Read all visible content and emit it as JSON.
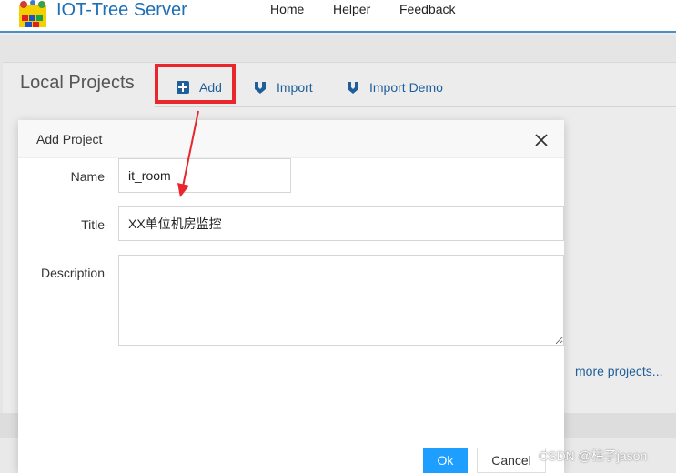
{
  "app": {
    "title": "IOT-Tree Server"
  },
  "nav": {
    "items": [
      {
        "label": "Home"
      },
      {
        "label": "Helper"
      },
      {
        "label": "Feedback"
      }
    ]
  },
  "panel": {
    "title": "Local Projects",
    "add_label": "Add",
    "import_label": "Import",
    "import_demo_label": "Import Demo",
    "more_projects": "more projects..."
  },
  "modal": {
    "title": "Add Project",
    "name_label": "Name",
    "name_value": "it_room",
    "title_label": "Title",
    "title_value": "XX单位机房监控",
    "description_label": "Description",
    "description_value": "",
    "ok_label": "Ok",
    "cancel_label": "Cancel"
  },
  "colors": {
    "accent": "#1f6fb5",
    "ok_button": "#1e9fff",
    "highlight": "#e8262b"
  },
  "watermark": "CSDN @柱子jason"
}
